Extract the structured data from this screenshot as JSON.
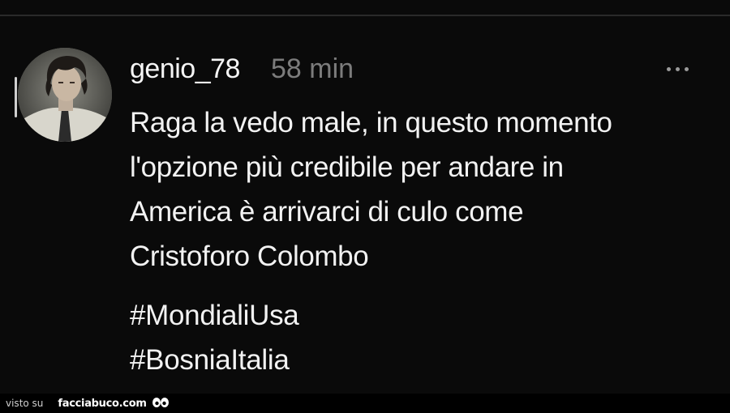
{
  "post": {
    "username": "genio_78",
    "time": "58 min",
    "more_icon": "ellipsis-icon",
    "body_lines": [
      "Raga la vedo male, in questo momento",
      "l'opzione più credibile per andare in",
      "America è arrivarci di culo come",
      "Cristoforo Colombo"
    ],
    "hashtags": [
      "#MondialiUsa",
      "#BosniaItalia"
    ]
  },
  "footer": {
    "label": "visto su",
    "site": "facciabuco.com",
    "logo_icon": "eyes-icon"
  },
  "colors": {
    "background": "#0a0a0a",
    "text": "#f2f2f2",
    "muted": "#7c7c7c"
  }
}
